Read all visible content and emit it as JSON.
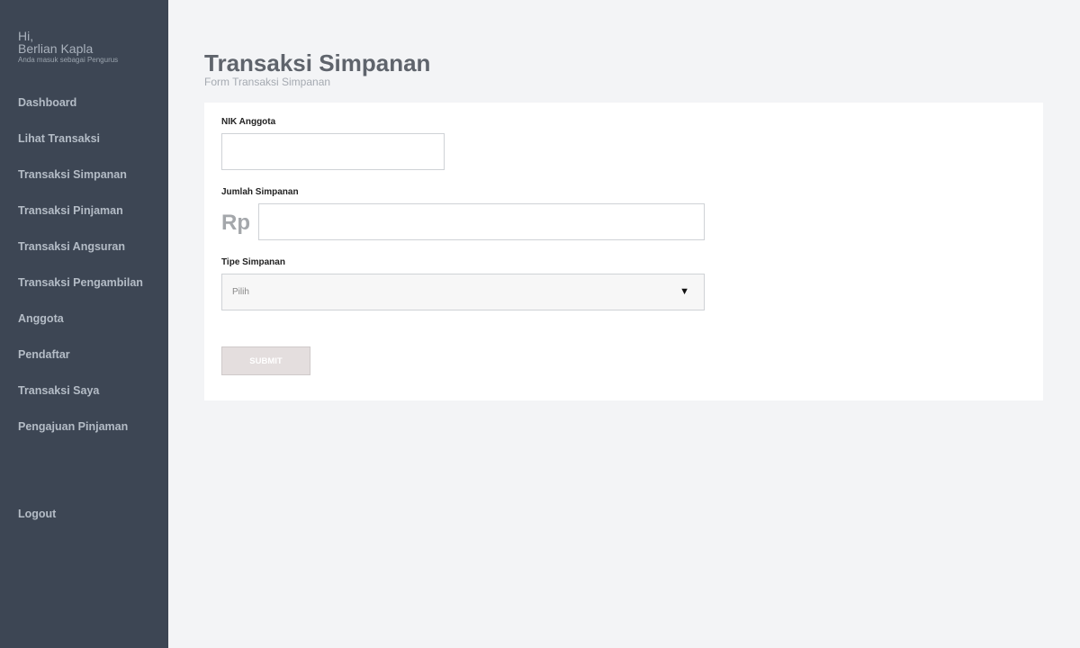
{
  "sidebar": {
    "greeting": "Hi,",
    "user_name": "Berlian Kapla",
    "role_text": "Anda masuk sebagai Pengurus",
    "items": [
      {
        "label": "Dashboard"
      },
      {
        "label": "Lihat Transaksi"
      },
      {
        "label": "Transaksi Simpanan"
      },
      {
        "label": "Transaksi Pinjaman"
      },
      {
        "label": "Transaksi Angsuran"
      },
      {
        "label": "Transaksi Pengambilan"
      },
      {
        "label": "Anggota"
      },
      {
        "label": "Pendaftar"
      },
      {
        "label": "Transaksi Saya"
      },
      {
        "label": "Pengajuan Pinjaman"
      }
    ],
    "logout_label": "Logout",
    "bg_color": "#3d4654"
  },
  "main": {
    "title": "Transaksi Simpanan",
    "subtitle": "Form Transaksi Simpanan",
    "form": {
      "nik_label": "NIK Anggota",
      "nik_value": "",
      "jumlah_label": "Jumlah Simpanan",
      "currency_prefix": "Rp",
      "jumlah_value": "",
      "tipe_label": "Tipe Simpanan",
      "tipe_selected": "Pilih",
      "submit_label": "SUBMIT"
    }
  }
}
